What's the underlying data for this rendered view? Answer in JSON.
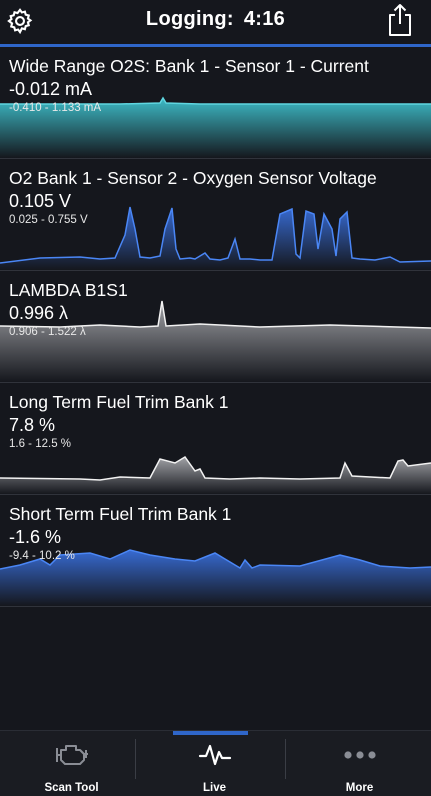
{
  "header": {
    "title": "Logging:",
    "elapsed": "4:16",
    "settings_icon": "gear-icon",
    "share_icon": "share-icon"
  },
  "colors": {
    "accent": "#2f66c9",
    "background": "#15171d",
    "teal": "#3fc3cf",
    "blue": "#3b74e6",
    "gray": "#d8d8d8"
  },
  "panels": [
    {
      "name": "Wide Range O2S: Bank 1 - Sensor 1 - Current",
      "value": "-0.012 mA",
      "range": "-0.410 - 1.133 mA",
      "color": "teal"
    },
    {
      "name": "O2 Bank 1 - Sensor 2 - Oxygen Sensor Voltage",
      "value": "0.105 V",
      "range": "0.025 - 0.755 V",
      "color": "blue"
    },
    {
      "name": "LAMBDA B1S1",
      "value": "0.996 λ",
      "range": "0.906 - 1.522 λ",
      "color": "gray"
    },
    {
      "name": "Long Term Fuel Trim Bank 1",
      "value": "7.8 %",
      "range": "1.6 - 12.5 %",
      "color": "gray"
    },
    {
      "name": "Short Term Fuel Trim Bank 1",
      "value": "-1.6 %",
      "range": "-9.4 - 10.2 %",
      "color": "blue"
    }
  ],
  "tabs": [
    {
      "label": "Scan Tool",
      "icon": "engine-icon",
      "active": false
    },
    {
      "label": "Live",
      "icon": "pulse-icon",
      "active": true
    },
    {
      "label": "More",
      "icon": "more-dots-icon",
      "active": false
    }
  ]
}
